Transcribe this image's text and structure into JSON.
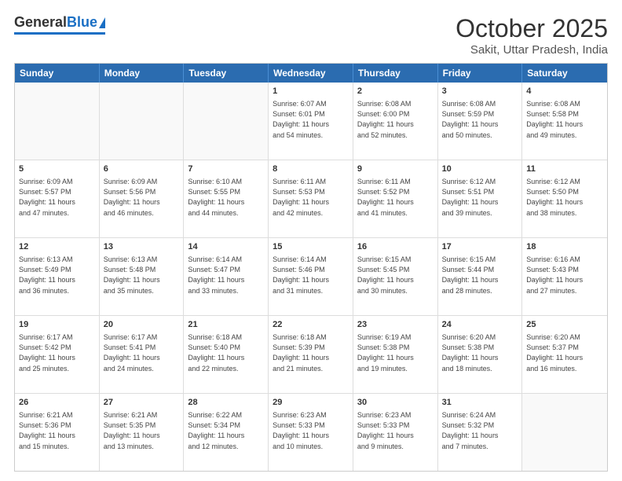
{
  "header": {
    "logo_general": "General",
    "logo_blue": "Blue",
    "month_title": "October 2025",
    "location": "Sakit, Uttar Pradesh, India"
  },
  "calendar": {
    "days_of_week": [
      "Sunday",
      "Monday",
      "Tuesday",
      "Wednesday",
      "Thursday",
      "Friday",
      "Saturday"
    ],
    "weeks": [
      [
        {
          "day": "",
          "info": ""
        },
        {
          "day": "",
          "info": ""
        },
        {
          "day": "",
          "info": ""
        },
        {
          "day": "1",
          "info": "Sunrise: 6:07 AM\nSunset: 6:01 PM\nDaylight: 11 hours\nand 54 minutes."
        },
        {
          "day": "2",
          "info": "Sunrise: 6:08 AM\nSunset: 6:00 PM\nDaylight: 11 hours\nand 52 minutes."
        },
        {
          "day": "3",
          "info": "Sunrise: 6:08 AM\nSunset: 5:59 PM\nDaylight: 11 hours\nand 50 minutes."
        },
        {
          "day": "4",
          "info": "Sunrise: 6:08 AM\nSunset: 5:58 PM\nDaylight: 11 hours\nand 49 minutes."
        }
      ],
      [
        {
          "day": "5",
          "info": "Sunrise: 6:09 AM\nSunset: 5:57 PM\nDaylight: 11 hours\nand 47 minutes."
        },
        {
          "day": "6",
          "info": "Sunrise: 6:09 AM\nSunset: 5:56 PM\nDaylight: 11 hours\nand 46 minutes."
        },
        {
          "day": "7",
          "info": "Sunrise: 6:10 AM\nSunset: 5:55 PM\nDaylight: 11 hours\nand 44 minutes."
        },
        {
          "day": "8",
          "info": "Sunrise: 6:11 AM\nSunset: 5:53 PM\nDaylight: 11 hours\nand 42 minutes."
        },
        {
          "day": "9",
          "info": "Sunrise: 6:11 AM\nSunset: 5:52 PM\nDaylight: 11 hours\nand 41 minutes."
        },
        {
          "day": "10",
          "info": "Sunrise: 6:12 AM\nSunset: 5:51 PM\nDaylight: 11 hours\nand 39 minutes."
        },
        {
          "day": "11",
          "info": "Sunrise: 6:12 AM\nSunset: 5:50 PM\nDaylight: 11 hours\nand 38 minutes."
        }
      ],
      [
        {
          "day": "12",
          "info": "Sunrise: 6:13 AM\nSunset: 5:49 PM\nDaylight: 11 hours\nand 36 minutes."
        },
        {
          "day": "13",
          "info": "Sunrise: 6:13 AM\nSunset: 5:48 PM\nDaylight: 11 hours\nand 35 minutes."
        },
        {
          "day": "14",
          "info": "Sunrise: 6:14 AM\nSunset: 5:47 PM\nDaylight: 11 hours\nand 33 minutes."
        },
        {
          "day": "15",
          "info": "Sunrise: 6:14 AM\nSunset: 5:46 PM\nDaylight: 11 hours\nand 31 minutes."
        },
        {
          "day": "16",
          "info": "Sunrise: 6:15 AM\nSunset: 5:45 PM\nDaylight: 11 hours\nand 30 minutes."
        },
        {
          "day": "17",
          "info": "Sunrise: 6:15 AM\nSunset: 5:44 PM\nDaylight: 11 hours\nand 28 minutes."
        },
        {
          "day": "18",
          "info": "Sunrise: 6:16 AM\nSunset: 5:43 PM\nDaylight: 11 hours\nand 27 minutes."
        }
      ],
      [
        {
          "day": "19",
          "info": "Sunrise: 6:17 AM\nSunset: 5:42 PM\nDaylight: 11 hours\nand 25 minutes."
        },
        {
          "day": "20",
          "info": "Sunrise: 6:17 AM\nSunset: 5:41 PM\nDaylight: 11 hours\nand 24 minutes."
        },
        {
          "day": "21",
          "info": "Sunrise: 6:18 AM\nSunset: 5:40 PM\nDaylight: 11 hours\nand 22 minutes."
        },
        {
          "day": "22",
          "info": "Sunrise: 6:18 AM\nSunset: 5:39 PM\nDaylight: 11 hours\nand 21 minutes."
        },
        {
          "day": "23",
          "info": "Sunrise: 6:19 AM\nSunset: 5:38 PM\nDaylight: 11 hours\nand 19 minutes."
        },
        {
          "day": "24",
          "info": "Sunrise: 6:20 AM\nSunset: 5:38 PM\nDaylight: 11 hours\nand 18 minutes."
        },
        {
          "day": "25",
          "info": "Sunrise: 6:20 AM\nSunset: 5:37 PM\nDaylight: 11 hours\nand 16 minutes."
        }
      ],
      [
        {
          "day": "26",
          "info": "Sunrise: 6:21 AM\nSunset: 5:36 PM\nDaylight: 11 hours\nand 15 minutes."
        },
        {
          "day": "27",
          "info": "Sunrise: 6:21 AM\nSunset: 5:35 PM\nDaylight: 11 hours\nand 13 minutes."
        },
        {
          "day": "28",
          "info": "Sunrise: 6:22 AM\nSunset: 5:34 PM\nDaylight: 11 hours\nand 12 minutes."
        },
        {
          "day": "29",
          "info": "Sunrise: 6:23 AM\nSunset: 5:33 PM\nDaylight: 11 hours\nand 10 minutes."
        },
        {
          "day": "30",
          "info": "Sunrise: 6:23 AM\nSunset: 5:33 PM\nDaylight: 11 hours\nand 9 minutes."
        },
        {
          "day": "31",
          "info": "Sunrise: 6:24 AM\nSunset: 5:32 PM\nDaylight: 11 hours\nand 7 minutes."
        },
        {
          "day": "",
          "info": ""
        }
      ]
    ]
  }
}
